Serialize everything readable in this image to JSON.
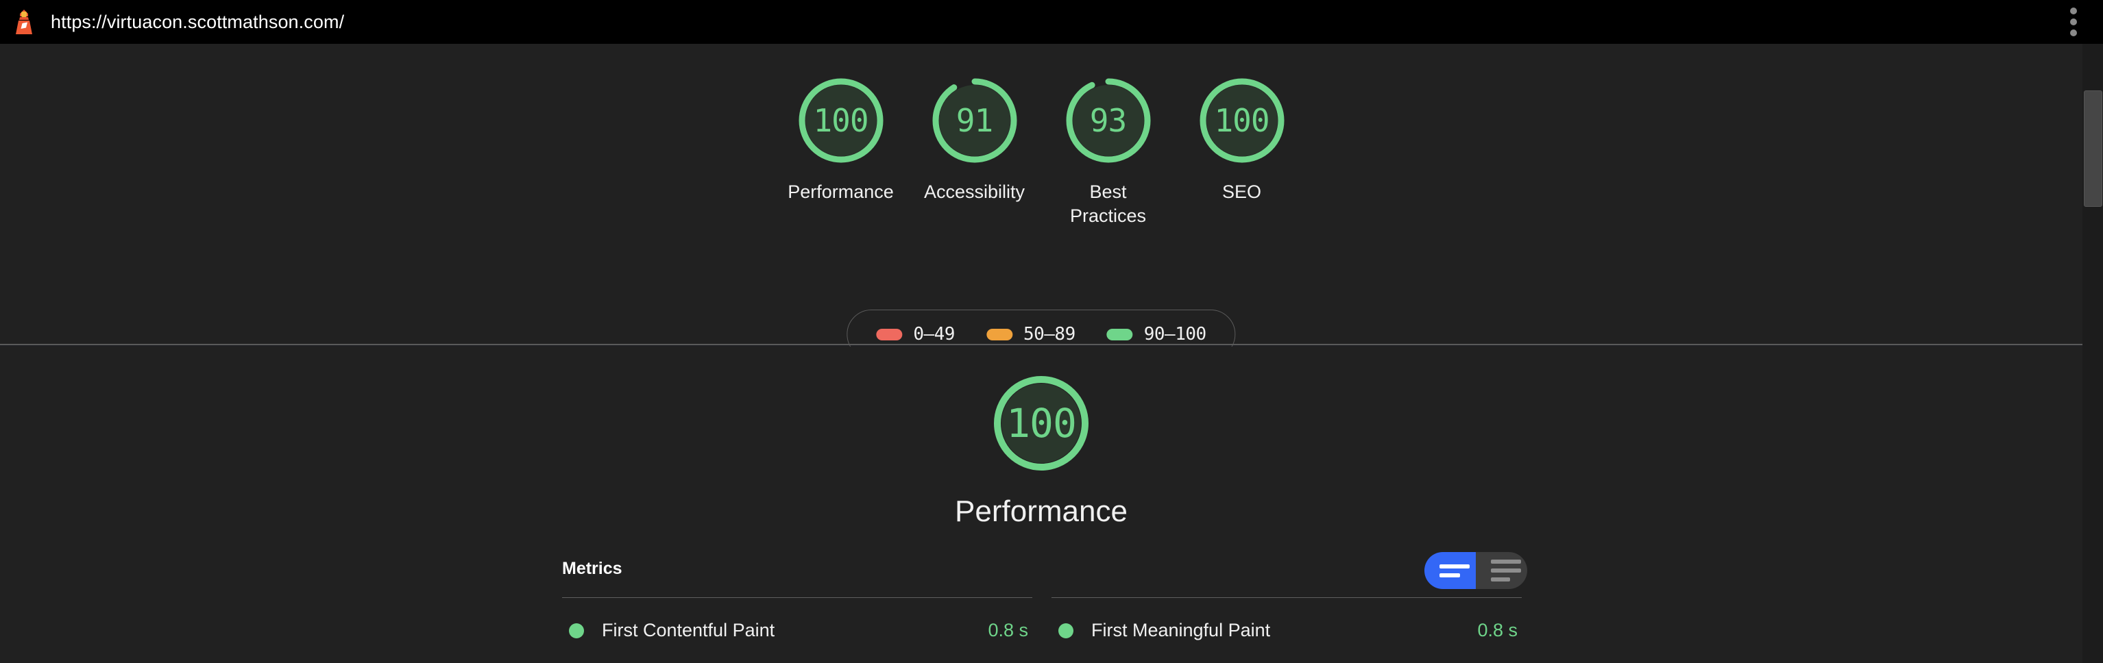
{
  "browser": {
    "url": "https://virtuacon.scottmathson.com/",
    "logo_icon": "lighthouse-icon",
    "menu_icon": "kebab-menu-icon"
  },
  "colors": {
    "pass": "#6fd58a",
    "average": "#f0a23c",
    "fail": "#ef6a5f",
    "background": "#212121",
    "topbar": "#000000",
    "accent_blue": "#3367f6"
  },
  "summary": {
    "gauges": [
      {
        "score": "100",
        "label": "Performance",
        "value": 100,
        "rating": "pass"
      },
      {
        "score": "91",
        "label": "Accessibility",
        "value": 91,
        "rating": "pass"
      },
      {
        "score": "93",
        "label": "Best Practices",
        "value": 93,
        "rating": "pass"
      },
      {
        "score": "100",
        "label": "SEO",
        "value": 100,
        "rating": "pass"
      }
    ],
    "legend": [
      {
        "range": "0–49",
        "color": "#ef6a5f"
      },
      {
        "range": "50–89",
        "color": "#f0a23c"
      },
      {
        "range": "90–100",
        "color": "#6fd58a"
      }
    ]
  },
  "category": {
    "score": "100",
    "value": 100,
    "title": "Performance",
    "metrics_heading": "Metrics",
    "toggle": {
      "active_view": "simple",
      "simple_label": "simple-view-icon",
      "expanded_label": "expanded-view-icon"
    },
    "metrics": [
      {
        "name": "First Contentful Paint",
        "value": "0.8 s",
        "rating": "pass"
      },
      {
        "name": "First Meaningful Paint",
        "value": "0.8 s",
        "rating": "pass"
      }
    ]
  }
}
